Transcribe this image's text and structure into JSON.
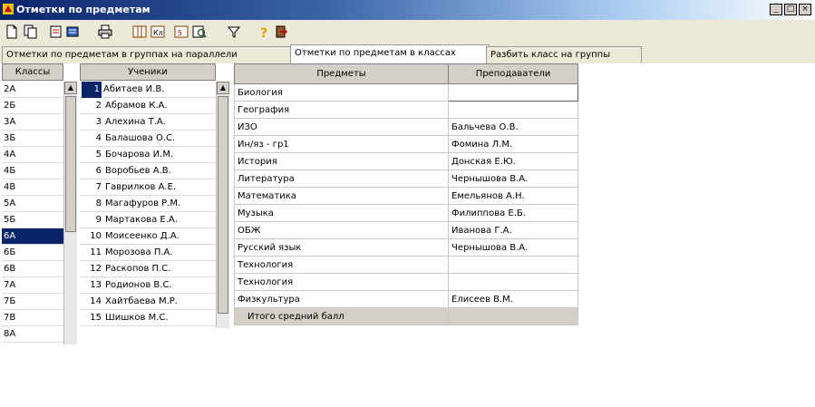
{
  "window": {
    "title": "Отметки по предметам",
    "buttons": [
      "_",
      "□",
      "×"
    ]
  },
  "toolbar": {
    "buttons": [
      {
        "icon": "new-document-icon"
      },
      {
        "icon": "copy-icon"
      },
      {
        "icon": "export-icon"
      },
      {
        "icon": "import-icon"
      },
      {
        "icon": "print-icon"
      },
      {
        "icon": "table-icon"
      },
      {
        "icon": "class-journal-icon"
      },
      {
        "icon": "grades-icon"
      },
      {
        "icon": "search-icon"
      },
      {
        "icon": "filter-icon"
      },
      {
        "icon": "help-icon"
      },
      {
        "icon": "exit-icon"
      }
    ]
  },
  "tabs": [
    {
      "label": "Отметки по предметам в группах на параллели",
      "active": false
    },
    {
      "label": "Отметки по предметам в классах",
      "active": true
    },
    {
      "label": "Разбить класс на группы",
      "active": false
    }
  ],
  "classes": {
    "header": "Классы",
    "items": [
      "2А",
      "2Б",
      "3А",
      "3Б",
      "4А",
      "4Б",
      "4В",
      "5А",
      "5Б",
      "6А",
      "6Б",
      "6В",
      "7А",
      "7Б",
      "7В",
      "8А"
    ],
    "selected": "6А"
  },
  "students": {
    "header": "Ученики",
    "items": [
      {
        "num": "1",
        "name": "Абитаев И.В."
      },
      {
        "num": "2",
        "name": "Абрамов К.А."
      },
      {
        "num": "3",
        "name": "Алехина Т.А."
      },
      {
        "num": "4",
        "name": "Балашова О.С."
      },
      {
        "num": "5",
        "name": "Бочарова И.М."
      },
      {
        "num": "6",
        "name": "Воробьев А.В."
      },
      {
        "num": "7",
        "name": "Гаврилков А.Е."
      },
      {
        "num": "8",
        "name": "Магафуров Р.М."
      },
      {
        "num": "9",
        "name": "Мартакова Е.А."
      },
      {
        "num": "10",
        "name": "Моисеенко Д.А."
      },
      {
        "num": "11",
        "name": "Морозова П.А."
      },
      {
        "num": "12",
        "name": "Раскопов П.С."
      },
      {
        "num": "13",
        "name": "Родионов В.С."
      },
      {
        "num": "14",
        "name": "Хайтбаева М.Р."
      },
      {
        "num": "15",
        "name": "Шишков М.С."
      }
    ],
    "selected": "1"
  },
  "subjects_table": {
    "headers": [
      "Предметы",
      "Преподаватели"
    ],
    "rows": [
      {
        "subject": "Биология",
        "teacher": ""
      },
      {
        "subject": "География",
        "teacher": ""
      },
      {
        "subject": "ИЗО",
        "teacher": "Бальчева О.В."
      },
      {
        "subject": "Ин/яз - гр1",
        "teacher": "Фомина Л.М."
      },
      {
        "subject": "История",
        "teacher": "Донская Е.Ю."
      },
      {
        "subject": "Литература",
        "teacher": "Чернышова В.А."
      },
      {
        "subject": "Математика",
        "teacher": "Емельянов А.Н."
      },
      {
        "subject": "Музыка",
        "teacher": "Филиппова Е.Б."
      },
      {
        "subject": "ОБЖ",
        "teacher": "Иванова Г.А."
      },
      {
        "subject": "Русский язык",
        "teacher": "Чернышова В.А."
      },
      {
        "subject": "Технология",
        "teacher": ""
      },
      {
        "subject": "Технология",
        "teacher": ""
      },
      {
        "subject": "Физкультура",
        "teacher": "Елисеев В.М."
      }
    ],
    "total_label": "Итого средний балл"
  },
  "colors": {
    "selection": "#0a246a",
    "chrome": "#ece9d8",
    "header": "#d4d0c8"
  }
}
